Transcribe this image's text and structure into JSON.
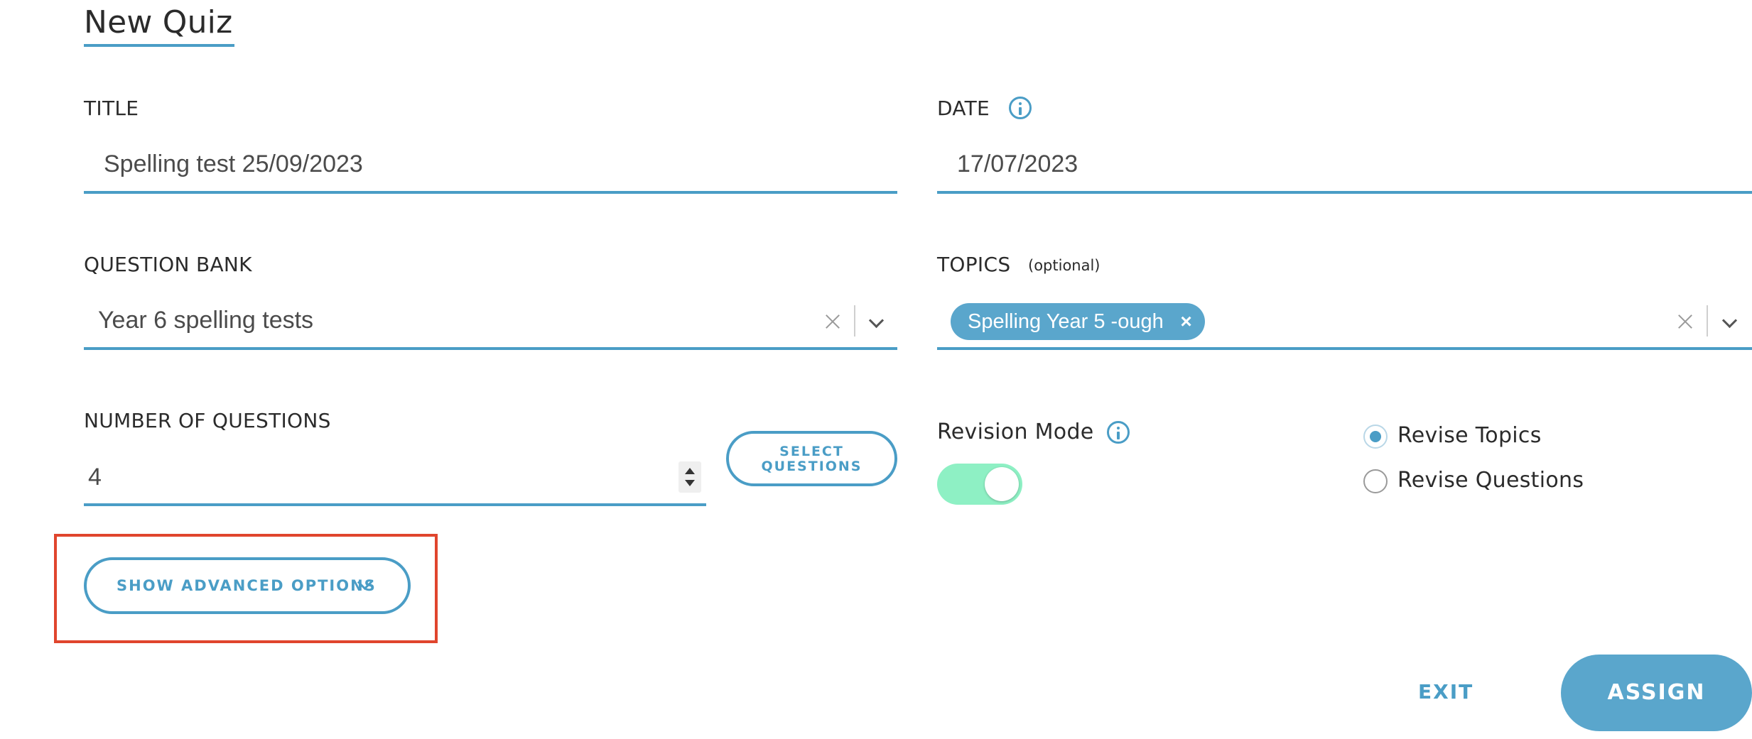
{
  "page": {
    "title": "New Quiz"
  },
  "title_field": {
    "label": "TITLE",
    "value": "Spelling test 25/09/2023"
  },
  "date_field": {
    "label": "DATE",
    "value": "17/07/2023",
    "info_icon": "info-icon"
  },
  "question_bank": {
    "label": "QUESTION BANK",
    "value": "Year 6 spelling tests"
  },
  "topics": {
    "label": "TOPICS",
    "optional": "(optional)",
    "chips": [
      "Spelling Year 5 -ough"
    ],
    "chip_remove": "×"
  },
  "num_questions": {
    "label": "NUMBER OF QUESTIONS",
    "value": "4",
    "select_button": "SELECT QUESTIONS"
  },
  "revision_mode": {
    "label": "Revision Mode",
    "enabled": true,
    "options": [
      {
        "label": "Revise Topics",
        "selected": true
      },
      {
        "label": "Revise Questions",
        "selected": false
      }
    ]
  },
  "advanced": {
    "label": "SHOW ADVANCED OPTIONS"
  },
  "actions": {
    "exit": "EXIT",
    "assign": "ASSIGN"
  },
  "colors": {
    "accent": "#4a9dc6",
    "chip": "#5aa6cc",
    "toggle_on": "#8ef0c4",
    "highlight": "#e0452d"
  }
}
